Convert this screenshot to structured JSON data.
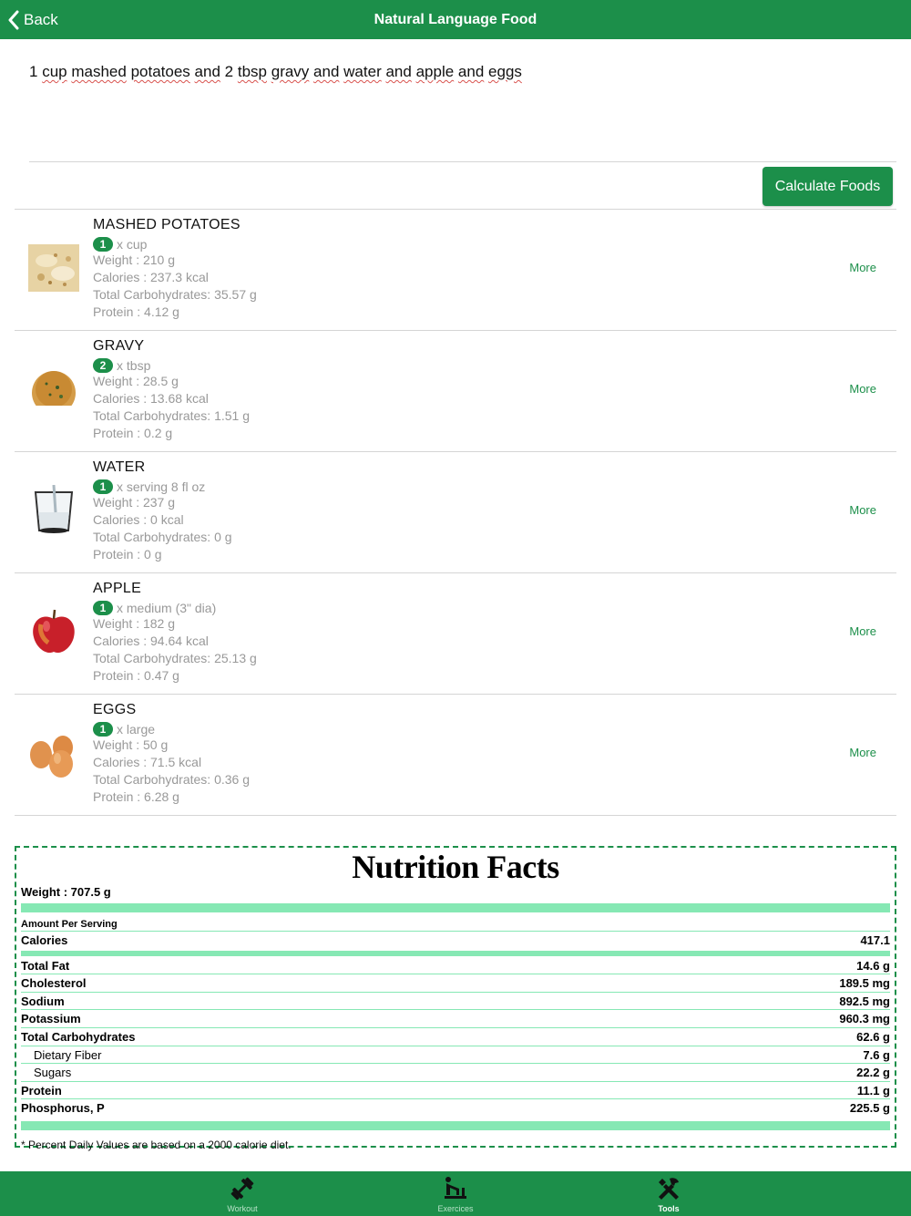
{
  "header": {
    "back_label": "Back",
    "title": "Natural Language Food"
  },
  "query": {
    "words": [
      "1",
      "cup",
      "mashed",
      "potatoes",
      "and",
      "2",
      "tbsp",
      "gravy",
      "and",
      "water",
      "and",
      "apple",
      "and",
      "eggs"
    ],
    "text": "1 cup mashed potatoes and 2 tbsp gravy and water and apple and eggs"
  },
  "calculate_label": "Calculate Foods",
  "foods": [
    {
      "name": "MASHED POTATOES",
      "qty": "1",
      "unit": "x cup",
      "weight": "Weight : 210 g",
      "calories": "Calories : 237.3 kcal",
      "carbs": "Total Carbohydrates: 35.57 g",
      "protein": "Protein : 4.12 g",
      "more": "More",
      "icon": "mashed-potatoes-image"
    },
    {
      "name": "GRAVY",
      "qty": "2",
      "unit": "x tbsp",
      "weight": "Weight : 28.5 g",
      "calories": "Calories : 13.68 kcal",
      "carbs": "Total Carbohydrates: 1.51 g",
      "protein": "Protein : 0.2 g",
      "more": "More",
      "icon": "gravy-image"
    },
    {
      "name": "WATER",
      "qty": "1",
      "unit": "x serving 8 fl oz",
      "weight": "Weight : 237 g",
      "calories": "Calories : 0 kcal",
      "carbs": "Total Carbohydrates: 0 g",
      "protein": "Protein : 0 g",
      "more": "More",
      "icon": "water-glass-image"
    },
    {
      "name": "APPLE",
      "qty": "1",
      "unit": "x medium (3\" dia)",
      "weight": "Weight : 182 g",
      "calories": "Calories : 94.64 kcal",
      "carbs": "Total Carbohydrates: 25.13 g",
      "protein": "Protein : 0.47 g",
      "more": "More",
      "icon": "apple-image"
    },
    {
      "name": "EGGS",
      "qty": "1",
      "unit": "x large",
      "weight": "Weight : 50 g",
      "calories": "Calories : 71.5 kcal",
      "carbs": "Total Carbohydrates: 0.36 g",
      "protein": "Protein : 6.28 g",
      "more": "More",
      "icon": "eggs-image"
    }
  ],
  "nutrition": {
    "title": "Nutrition Facts",
    "weight": "Weight : 707.5 g",
    "amount_per_serving": "Amount Per Serving",
    "calories_label": "Calories",
    "calories_value": "417.1",
    "rows": [
      {
        "label": "Total Fat",
        "value": "14.6 g",
        "sub": false
      },
      {
        "label": "Cholesterol",
        "value": "189.5 mg",
        "sub": false
      },
      {
        "label": "Sodium",
        "value": "892.5 mg",
        "sub": false
      },
      {
        "label": "Potassium",
        "value": "960.3 mg",
        "sub": false
      },
      {
        "label": "Total Carbohydrates",
        "value": "62.6 g",
        "sub": false
      },
      {
        "label": "Dietary Fiber",
        "value": "7.6 g",
        "sub": true
      },
      {
        "label": "Sugars",
        "value": "22.2 g",
        "sub": true
      },
      {
        "label": "Protein",
        "value": "11.1 g",
        "sub": false
      },
      {
        "label": "Phosphorus, P",
        "value": "225.5 g",
        "sub": false
      }
    ],
    "footnote": "* Percent Daily Values are based on a 2000 calorie diet."
  },
  "tabs": [
    {
      "label": "Workout",
      "icon": "dumbbell-icon",
      "active": false
    },
    {
      "label": "Exercices",
      "icon": "exercise-person-icon",
      "active": false
    },
    {
      "label": "Tools",
      "icon": "tools-icon",
      "active": true
    }
  ],
  "colors": {
    "brand_green": "#1c8f4a",
    "nutrition_bar": "#86e8b4",
    "muted_text": "#999999"
  }
}
